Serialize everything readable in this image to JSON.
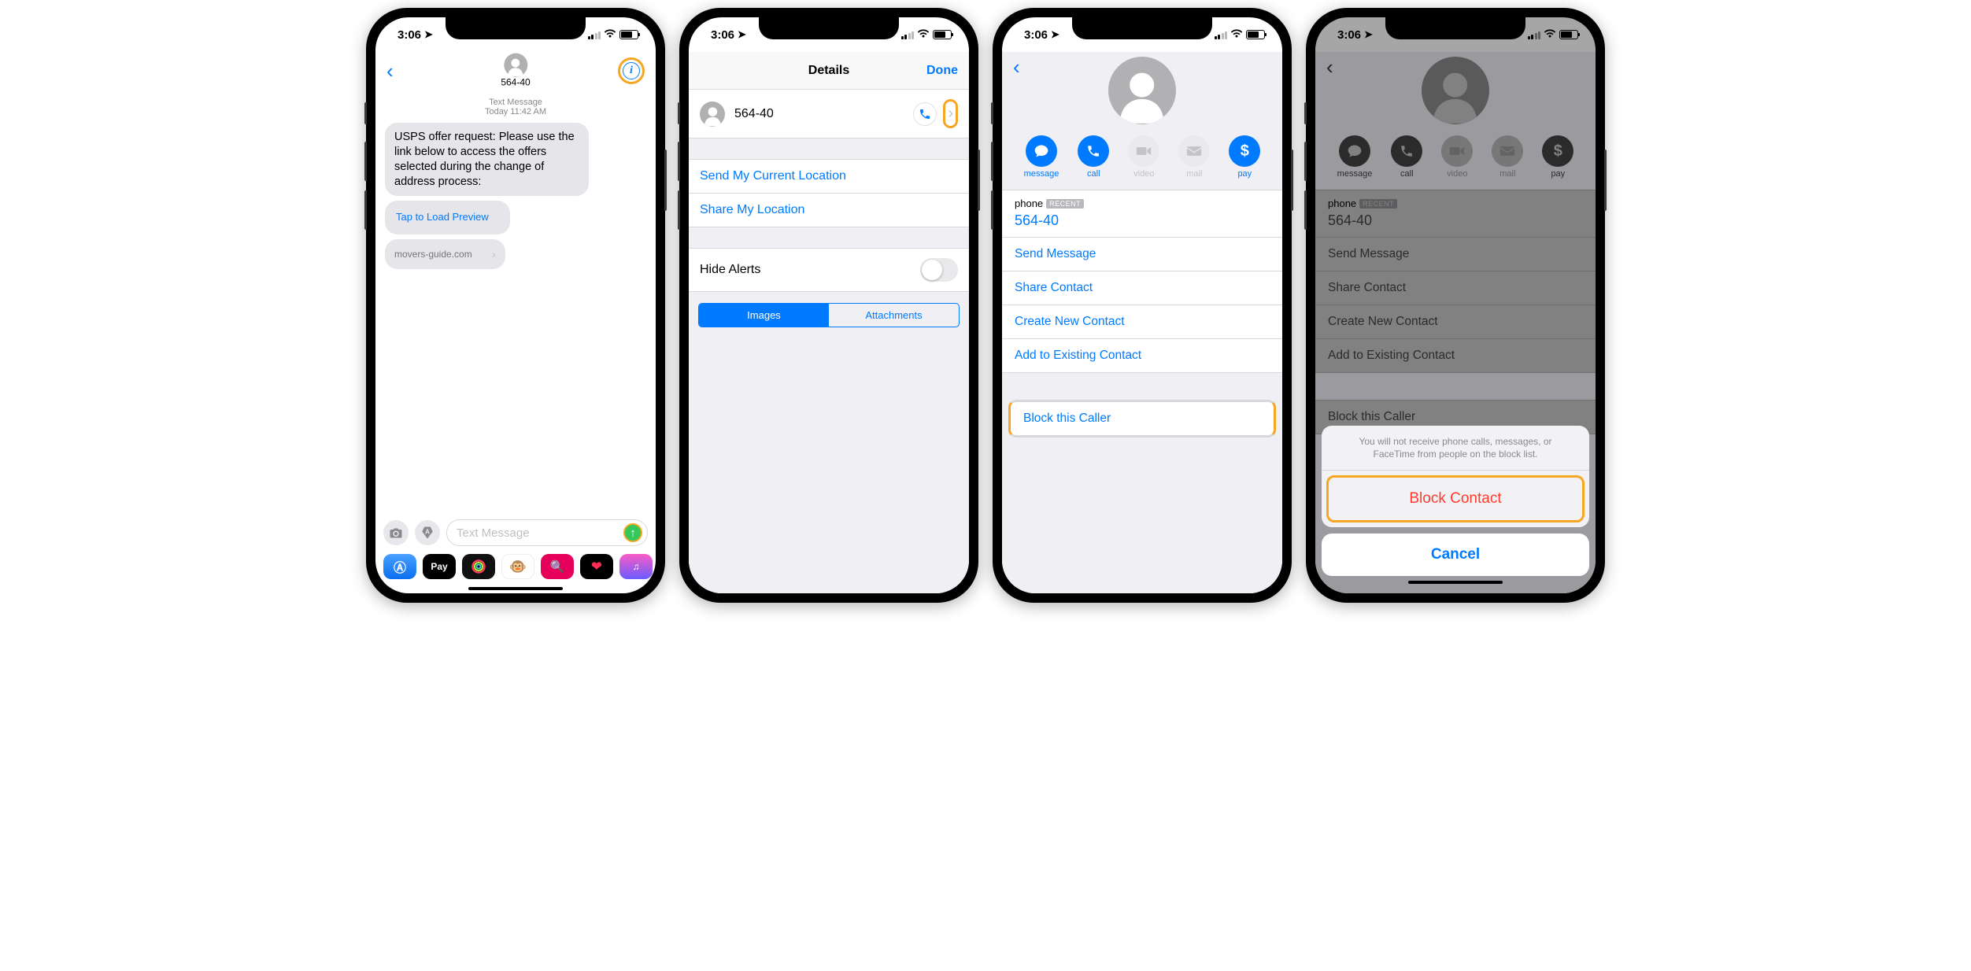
{
  "status": {
    "time": "3:06"
  },
  "screen1": {
    "contact": "564-40",
    "meta_kind": "Text Message",
    "meta_day": "Today",
    "meta_time": "11:42 AM",
    "msg_body": "USPS offer request: Please use the link below to access the offers selected during the change of address process:",
    "preview_label": "Tap to Load Preview",
    "attach_domain": "movers-guide.com",
    "compose_placeholder": "Text Message",
    "tray": {
      "pay": "Pay"
    }
  },
  "screen2": {
    "title": "Details",
    "done": "Done",
    "contact": "564-40",
    "send_loc": "Send My Current Location",
    "share_loc": "Share My Location",
    "hide_alerts": "Hide Alerts",
    "seg_images": "Images",
    "seg_attachments": "Attachments"
  },
  "contact_card": {
    "actions": {
      "message": "message",
      "call": "call",
      "video": "video",
      "mail": "mail",
      "pay": "pay"
    },
    "phone_label": "phone",
    "recent": "RECENT",
    "phone_value": "564-40",
    "send_message": "Send Message",
    "share_contact": "Share Contact",
    "create_new": "Create New Contact",
    "add_existing": "Add to Existing Contact",
    "block_caller": "Block this Caller"
  },
  "sheet": {
    "message": "You will not receive phone calls, messages, or FaceTime from people on the block list.",
    "block": "Block Contact",
    "cancel": "Cancel"
  }
}
